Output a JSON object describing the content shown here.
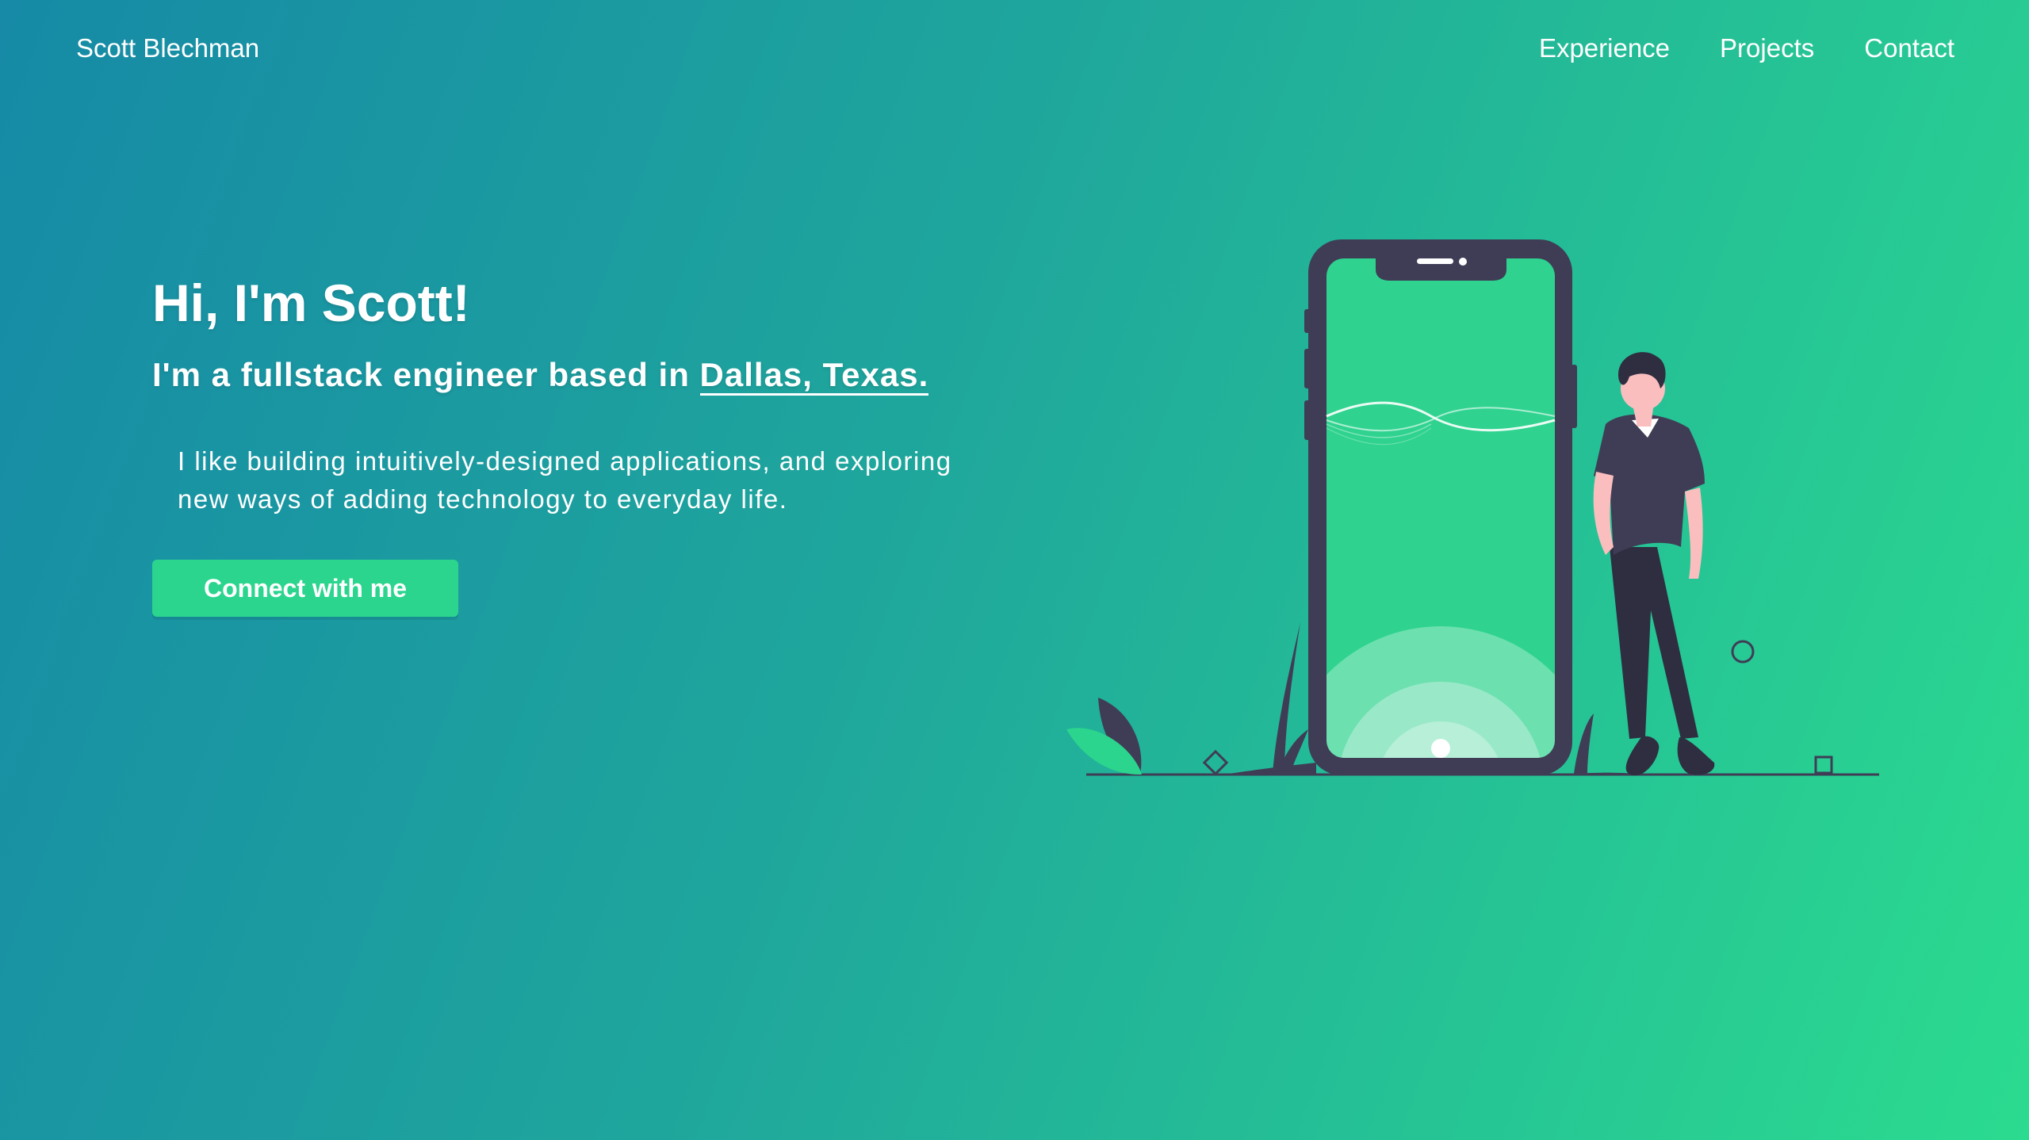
{
  "nav": {
    "brand": "Scott Blechman",
    "links": [
      "Experience",
      "Projects",
      "Contact"
    ]
  },
  "hero": {
    "title": "Hi, I'm Scott!",
    "subtitle_prefix": "I'm a fullstack engineer based in ",
    "location": "Dallas, Texas.",
    "description": "I like building intuitively-designed applications, and exploring new ways of adding technology to everyday life.",
    "cta_label": "Connect with me"
  },
  "illustration": {
    "icon": "person-leaning-on-phone-illustration"
  },
  "colors": {
    "accent": "#2bd58e",
    "gradient_start": "#168aa6",
    "gradient_end": "#2bdb8f",
    "phone_body": "#3f3d56",
    "phone_screen": "#2fd38f"
  }
}
